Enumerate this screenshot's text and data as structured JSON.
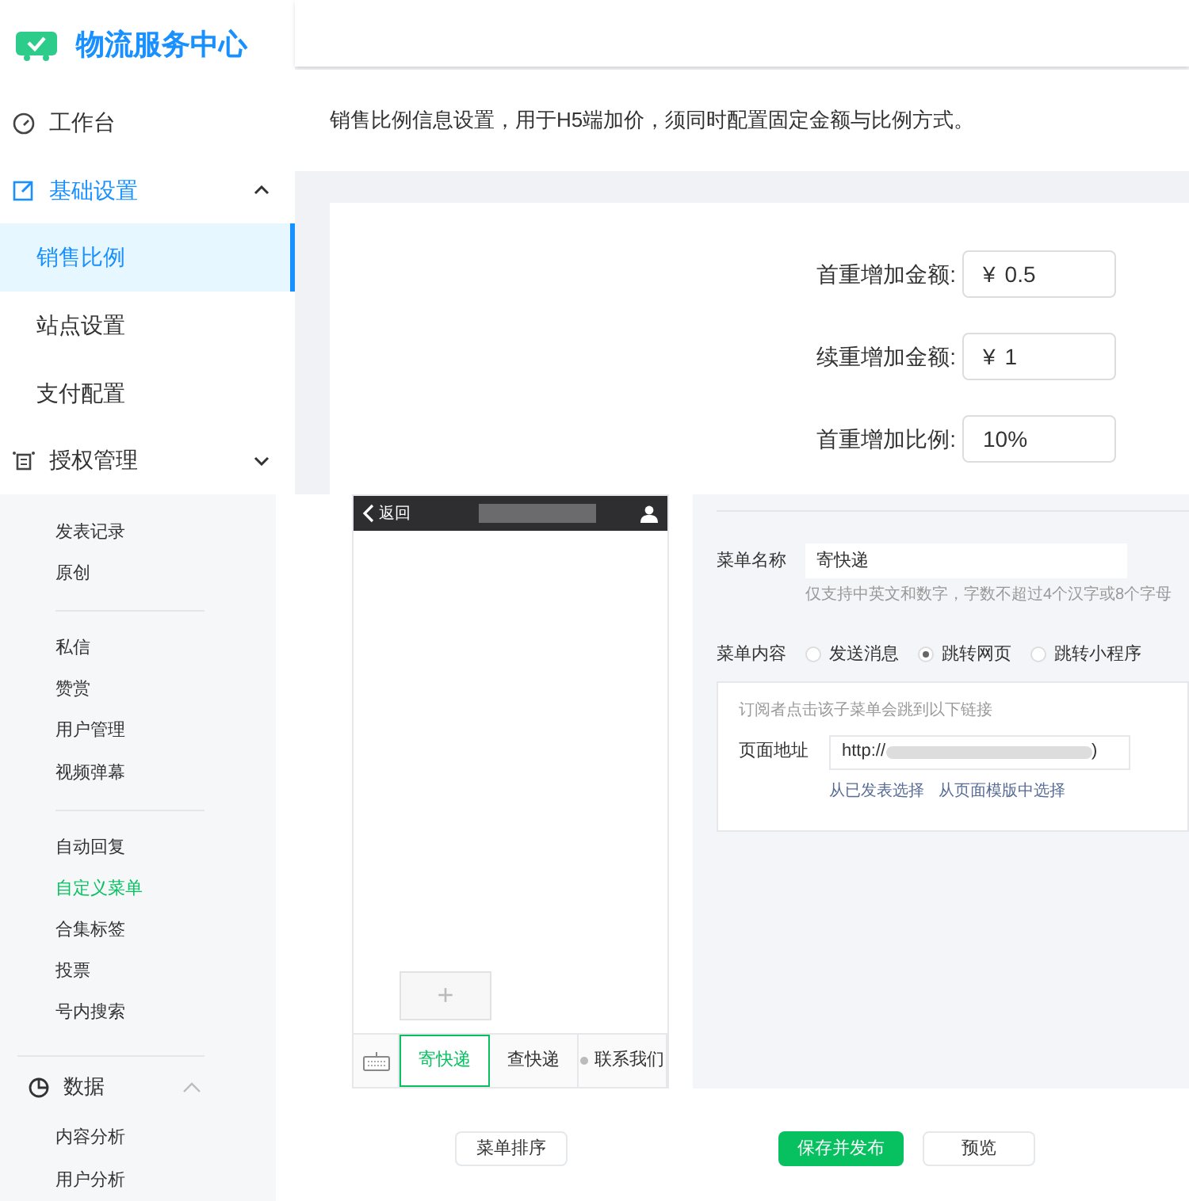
{
  "top": {
    "brand": {
      "title": "物流服务中心"
    },
    "nav": [
      {
        "label": "工作台",
        "expanded": false
      },
      {
        "label": "基础设置",
        "expanded": true,
        "children": [
          {
            "label": "销售比例",
            "selected": true
          },
          {
            "label": "站点设置",
            "selected": false
          },
          {
            "label": "支付配置",
            "selected": false
          }
        ]
      },
      {
        "label": "授权管理",
        "expanded": false
      }
    ],
    "description": "销售比例信息设置，用于H5端加价，须同时配置固定金额与比例方式。",
    "form": [
      {
        "label": "首重增加金额:",
        "prefix": "¥",
        "value": "0.5"
      },
      {
        "label": "续重增加金额:",
        "prefix": "¥",
        "value": "1"
      },
      {
        "label": "首重增加比例:",
        "value": "10%"
      }
    ]
  },
  "bottom": {
    "sidebar": {
      "groups": [
        [
          {
            "label": "发表记录",
            "selected": false
          },
          {
            "label": "原创",
            "selected": false
          }
        ],
        [
          {
            "label": "私信",
            "selected": false
          },
          {
            "label": "赞赏",
            "selected": false
          },
          {
            "label": "用户管理",
            "selected": false
          },
          {
            "label": "视频弹幕",
            "selected": false
          }
        ],
        [
          {
            "label": "自动回复",
            "selected": false
          },
          {
            "label": "自定义菜单",
            "selected": true
          },
          {
            "label": "合集标签",
            "selected": false
          },
          {
            "label": "投票",
            "selected": false
          },
          {
            "label": "号内搜索",
            "selected": false
          }
        ]
      ],
      "section": {
        "label": "数据",
        "expanded": true,
        "children": [
          {
            "label": "内容分析",
            "selected": false
          },
          {
            "label": "用户分析",
            "selected": false
          }
        ]
      }
    },
    "phone": {
      "back": "返回",
      "add": "+",
      "menu": [
        {
          "label": "寄快递",
          "selected": true,
          "submenu_dot": false
        },
        {
          "label": "查快递",
          "selected": false,
          "submenu_dot": false
        },
        {
          "label": "联系我们",
          "selected": false,
          "submenu_dot": true
        }
      ]
    },
    "editor": {
      "name_label": "菜单名称",
      "name_value": "寄快递",
      "name_hint": "仅支持中英文和数字，字数不超过4个汉字或8个字母",
      "content_label": "菜单内容",
      "options": [
        {
          "label": "发送消息",
          "selected": false
        },
        {
          "label": "跳转网页",
          "selected": true
        },
        {
          "label": "跳转小程序",
          "selected": false
        }
      ],
      "link_hint": "订阅者点击该子菜单会跳到以下链接",
      "url_label": "页面地址",
      "url_start": "http://",
      "url_end": ")",
      "links": [
        "从已发表选择",
        "从页面模版中选择"
      ]
    },
    "buttons": [
      {
        "label": "菜单排序",
        "kind": "default"
      },
      {
        "label": "保存并发布",
        "kind": "primary"
      },
      {
        "label": "预览",
        "kind": "default"
      }
    ]
  }
}
